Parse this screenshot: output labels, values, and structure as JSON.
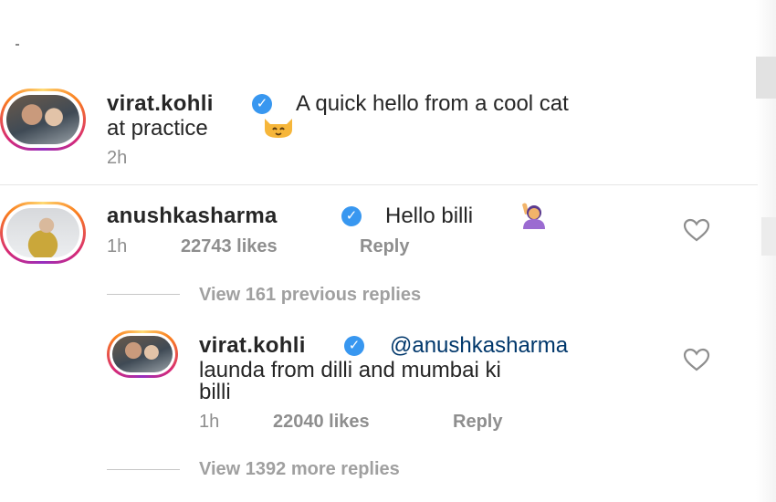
{
  "post": {
    "username": "virat.kohli",
    "caption_line1": "A quick hello from a cool cat",
    "caption_line2": "at practice",
    "time": "2h"
  },
  "comment": {
    "username": "anushkasharma",
    "text": "Hello billi",
    "time": "1h",
    "likes": "22743 likes",
    "reply_label": "Reply",
    "view_previous": "View 161 previous replies"
  },
  "reply": {
    "username": "virat.kohli",
    "mention": "@anushkasharma",
    "text_line1": "launda from dilli and mumbai ki",
    "text_line2": "billi",
    "time": "1h",
    "likes": "22040 likes",
    "reply_label": "Reply",
    "view_more": "View 1392 more replies"
  },
  "icons": {
    "verified": "verified-badge-icon",
    "heart": "heart-outline-icon",
    "cat_emoji": "cat-face-emoji",
    "woman_raising_hand_emoji": "woman-raising-hand-emoji"
  }
}
